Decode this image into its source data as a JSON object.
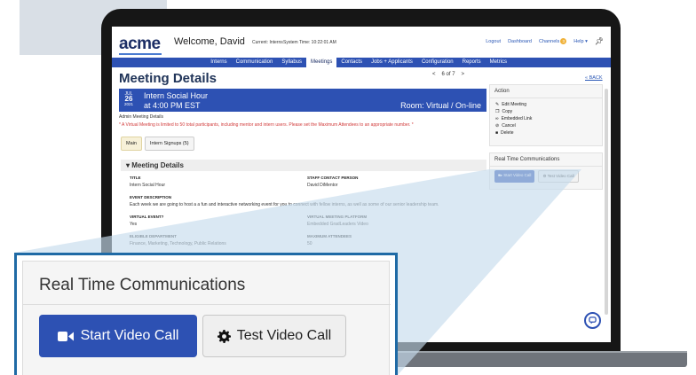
{
  "header": {
    "logo": "acme",
    "welcome": "Welcome, David",
    "current_role": "Current: Interns",
    "system_time": "System Time: 10:22:01 AM",
    "links": [
      "Logout",
      "Dashboard",
      "Channels",
      "Help ▾"
    ],
    "channels_badge": "3"
  },
  "nav": {
    "items": [
      "Interns",
      "Communication",
      "Syllabus",
      "Meetings",
      "Contacts",
      "Jobs + Applicants",
      "Configuration",
      "Reports",
      "Metrics"
    ],
    "active": "Meetings"
  },
  "page": {
    "title": "Meeting Details",
    "pager": "6 of 7",
    "back": "« BACK"
  },
  "meeting": {
    "month": "JUL",
    "day": "26",
    "year": "2021",
    "title": "Intern Social Hour",
    "time": "at 4:00 PM EST",
    "room": "Room: Virtual / On-line",
    "admin_label": "Admin Meeting Details",
    "warning": "* A Virtual Meeting is limited to 50 total participants, including mentor and intern users. Please set the Maximum Attendees to an appropriate number. *"
  },
  "tabs": [
    "Main",
    "Intern Signups (5)"
  ],
  "details": {
    "section_title": "Meeting Details",
    "title_label": "TITLE",
    "title_value": "Intern Social Hour",
    "staff_label": "STAFF CONTACT PERSON",
    "staff_value": "David DiMentor",
    "desc_label": "EVENT DESCRIPTION",
    "desc_value": "Each week we are going to host a a fun and interactive networking event for you to connect with fellow interns, as well as some of our senior leadership team.",
    "virtual_label": "VIRTUAL EVENT?",
    "virtual_value": "Yes",
    "platform_label": "VIRTUAL MEETING PLATFORM",
    "platform_value": "Embedded GradLeaders Video",
    "dept_label": "ELIGIBLE DEPARTMENT",
    "dept_value": "Finance, Marketing, Technology, Public Relations",
    "max_label": "MAXIMUM ATTENDEES",
    "max_value": "50"
  },
  "actions": {
    "title": "Action",
    "items": [
      "Edit Meeting",
      "Copy",
      "Embedded Link",
      "Cancel",
      "Delete"
    ]
  },
  "rtc": {
    "title": "Real Time Communications",
    "start": "Start Video Call",
    "test": "Test Video Call"
  },
  "colors": {
    "nav_blue": "#2d51b3",
    "title_navy": "#1f3358",
    "warning_red": "#d13a3a",
    "callout_border": "#1f6aa5"
  }
}
